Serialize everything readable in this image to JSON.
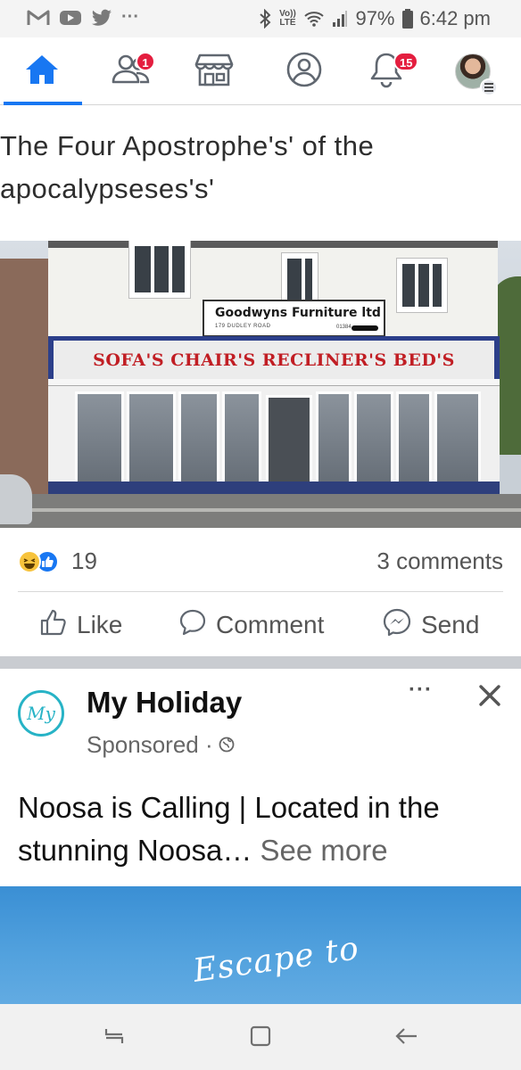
{
  "status_bar": {
    "left_icons": [
      "gmail-icon",
      "youtube-icon",
      "twitter-icon",
      "more-dots-icon"
    ],
    "more_label": "···",
    "volte_label": "Vo)) LTE",
    "battery": "97%",
    "time": "6:42 pm"
  },
  "nav": {
    "friends_badge": "1",
    "notifications_badge": "15",
    "accent_color": "#1877f2",
    "badge_color": "#e41e3f"
  },
  "post": {
    "text": "The Four Apostrophe's' of the\napocalypseses's'",
    "image": {
      "sign_small_title": "Goodwyns Furniture ltd",
      "sign_small_sub": "179 DUDLEY ROAD",
      "sign_small_num": "01384",
      "sign_main_text": "SOFA'S CHAIR'S RECLINER'S BED'S"
    },
    "reaction_count": "19",
    "comments_count": "3 comments",
    "actions": {
      "like": "Like",
      "comment": "Comment",
      "send": "Send"
    }
  },
  "sponsored": {
    "logo_text": "My",
    "name": "My Holiday",
    "subtitle": "Sponsored ·",
    "more_label": "···",
    "text": "Noosa is Calling | Located in the stunning Noosa…",
    "see_more": "See more",
    "ad_script": "Escape to"
  }
}
